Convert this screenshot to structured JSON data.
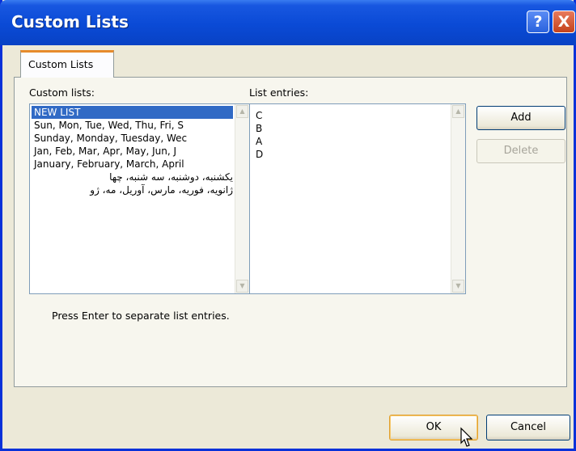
{
  "window": {
    "title": "Custom Lists",
    "help_label": "?",
    "close_label": "X"
  },
  "tabs": [
    {
      "label": "Custom Lists"
    }
  ],
  "custom_lists": {
    "label": "Custom lists:",
    "items": [
      "NEW LIST",
      "Sun, Mon, Tue, Wed, Thu, Fri, S",
      "Sunday, Monday, Tuesday, Wec",
      "Jan, Feb, Mar, Apr, May, Jun, J",
      "January, February, March, April",
      "یکشنبه، دوشنبه، سه شنبه، چها",
      "ژانویه، فوریه، مارس، آوریل، مه، ژو"
    ],
    "selected_index": 0
  },
  "list_entries": {
    "label": "List entries:",
    "lines": [
      "C",
      "B",
      "A",
      "D"
    ]
  },
  "buttons": {
    "add": "Add",
    "delete": "Delete",
    "ok": "OK",
    "cancel": "Cancel"
  },
  "hint": "Press Enter to separate list entries.",
  "colors": {
    "titlebar": "#0a4ad6",
    "selection": "#316ac5",
    "dialog_bg": "#ece9d8"
  }
}
